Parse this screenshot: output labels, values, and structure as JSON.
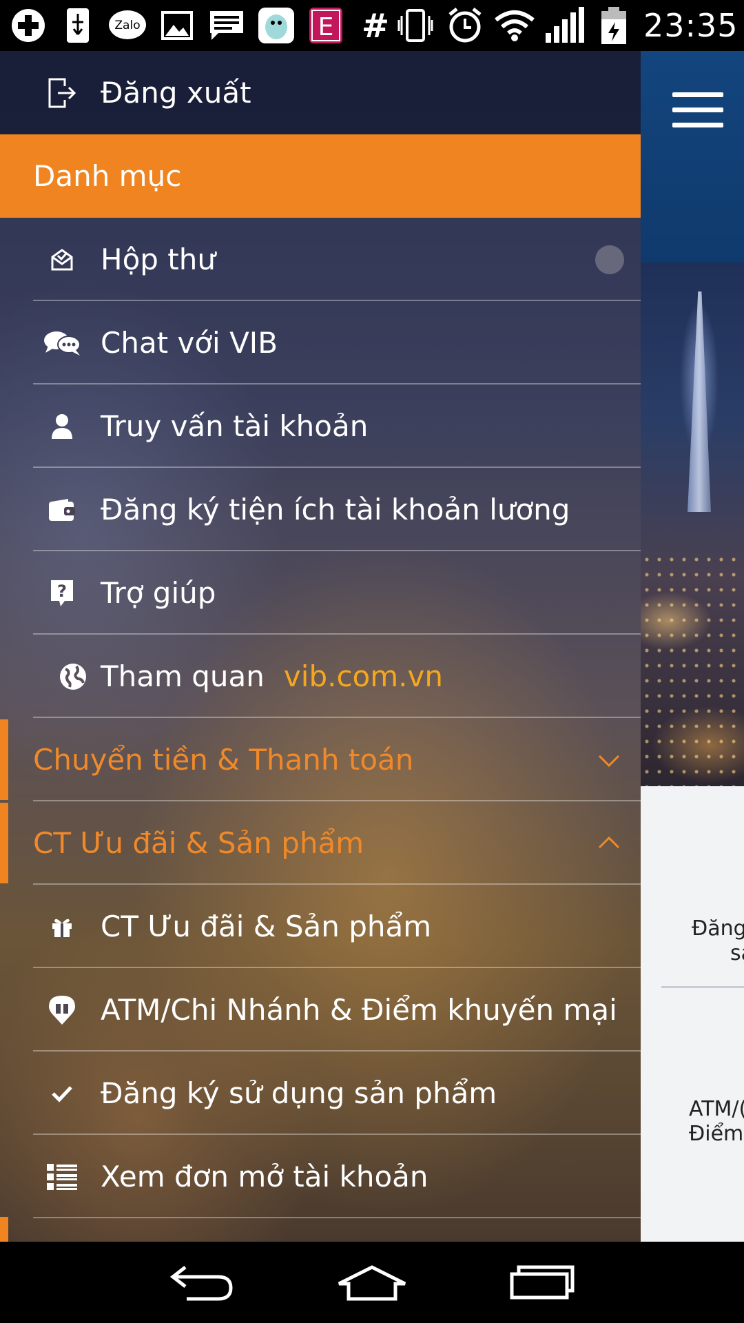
{
  "status_bar": {
    "time": "23:35",
    "icons": [
      "add-icon",
      "usb-icon",
      "zalo-icon",
      "gallery-icon",
      "message-icon",
      "sticker-app-icon",
      "e-app-icon",
      "hash-icon",
      "vibrate-icon",
      "alarm-icon",
      "wifi-icon",
      "signal-icon",
      "battery-charging-icon"
    ],
    "zalo_label": "Zalo",
    "e_app_label": "E",
    "hash_label": "#"
  },
  "drawer": {
    "logout_label": "Đăng xuất",
    "category_title": "Danh mục",
    "items": [
      {
        "label": "Hộp thư",
        "icon": "inbox-icon"
      },
      {
        "label": "Chat với VIB",
        "icon": "chat-icon"
      },
      {
        "label": "Truy vấn tài khoản",
        "icon": "user-icon"
      },
      {
        "label": "Đăng ký tiện ích tài khoản lương",
        "icon": "wallet-icon"
      },
      {
        "label": "Trợ giúp",
        "icon": "help-icon"
      },
      {
        "label": "Tham quan",
        "link": "vib.com.vn",
        "icon": "globe-icon"
      }
    ],
    "sections": [
      {
        "label": "Chuyển tiền & Thanh toán",
        "expanded": false
      },
      {
        "label": "CT Ưu đãi & Sản phẩm",
        "expanded": true
      }
    ],
    "sub_items": [
      {
        "label": "CT Ưu đãi & Sản phẩm",
        "icon": "gift-icon"
      },
      {
        "label": "ATM/Chi Nhánh & Điểm khuyến mại",
        "icon": "location-gift-icon"
      },
      {
        "label": "Đăng ký sử dụng sản phẩm",
        "icon": "check-icon"
      },
      {
        "label": "Xem đơn mở tài khoản",
        "icon": "list-icon"
      }
    ]
  },
  "background_page": {
    "card1_line1": "Đăng",
    "card1_line2": "sả",
    "card2_line1": "ATM/(",
    "card2_line2": "Điểm"
  },
  "colors": {
    "accent": "#ef8420",
    "link": "#f5a81e",
    "header_blue": "#13457e"
  }
}
